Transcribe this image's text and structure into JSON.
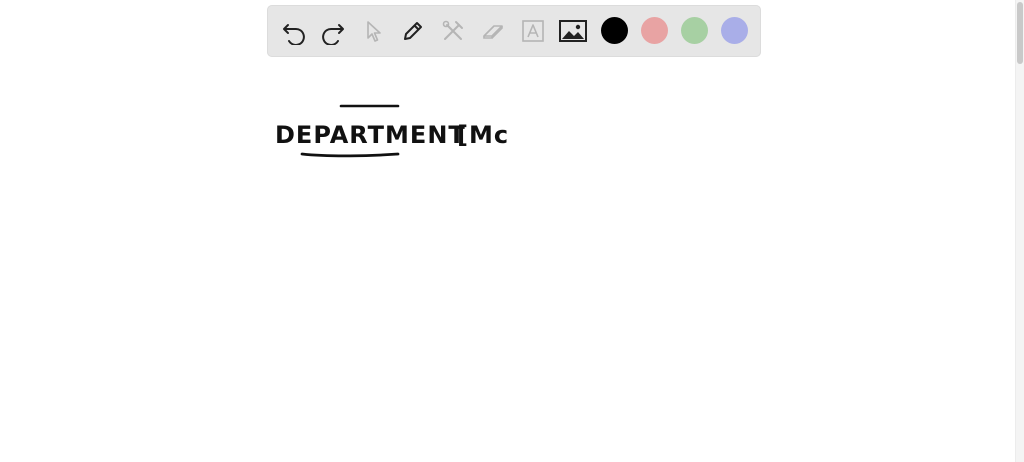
{
  "toolbar": {
    "tools": [
      {
        "name": "undo-icon",
        "enabled": true
      },
      {
        "name": "redo-icon",
        "enabled": true
      },
      {
        "name": "pointer-icon",
        "enabled": false
      },
      {
        "name": "pen-icon",
        "enabled": true
      },
      {
        "name": "tools-icon",
        "enabled": false
      },
      {
        "name": "eraser-icon",
        "enabled": false
      },
      {
        "name": "text-box-icon",
        "enabled": false
      },
      {
        "name": "image-icon",
        "enabled": true
      }
    ],
    "colors": [
      "#000000",
      "#e8a3a3",
      "#a7d0a3",
      "#a9aee8"
    ]
  },
  "canvas": {
    "handwriting_line1": "DEPARTMENT",
    "handwriting_line2": "[Mc"
  }
}
